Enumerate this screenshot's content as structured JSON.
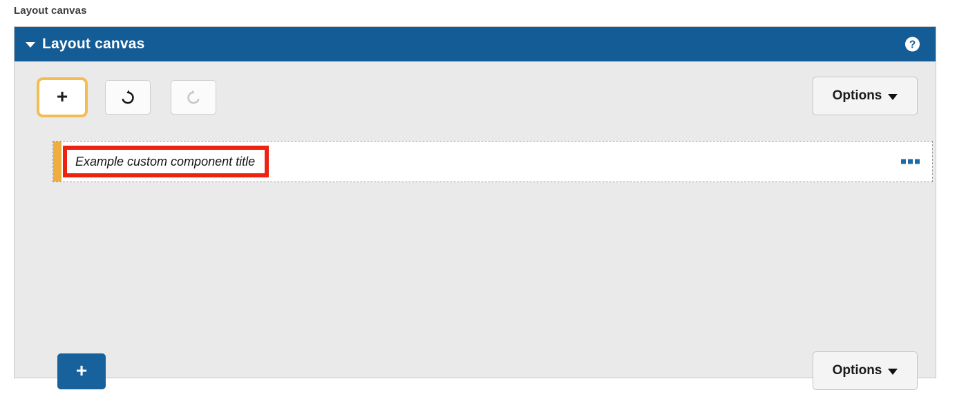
{
  "caption": "Layout canvas",
  "panel": {
    "title": "Layout canvas",
    "collapse_icon": "caret-down-icon",
    "help_icon": "help-circle-icon",
    "header_color": "#145c96"
  },
  "toolbar": {
    "add_button": {
      "icon": "plus-icon",
      "glyph": "+",
      "focused": true,
      "focus_ring_color": "#f3bd52"
    },
    "undo_button": {
      "icon": "undo-arrow-icon",
      "enabled": true
    },
    "redo_button": {
      "icon": "redo-arrow-icon",
      "enabled": false
    },
    "options_button": {
      "label": "Options",
      "icon": "chevron-down-icon"
    }
  },
  "component_row": {
    "drag_handle_color": "#f0ad3f",
    "title": "Example custom component title",
    "highlight_color": "#ee2211",
    "menu_icon": "ellipsis-icon"
  },
  "footer": {
    "add_button": {
      "icon": "plus-icon",
      "glyph": "+",
      "color": "#17619c"
    },
    "options_button": {
      "label": "Options",
      "icon": "chevron-down-icon"
    }
  }
}
